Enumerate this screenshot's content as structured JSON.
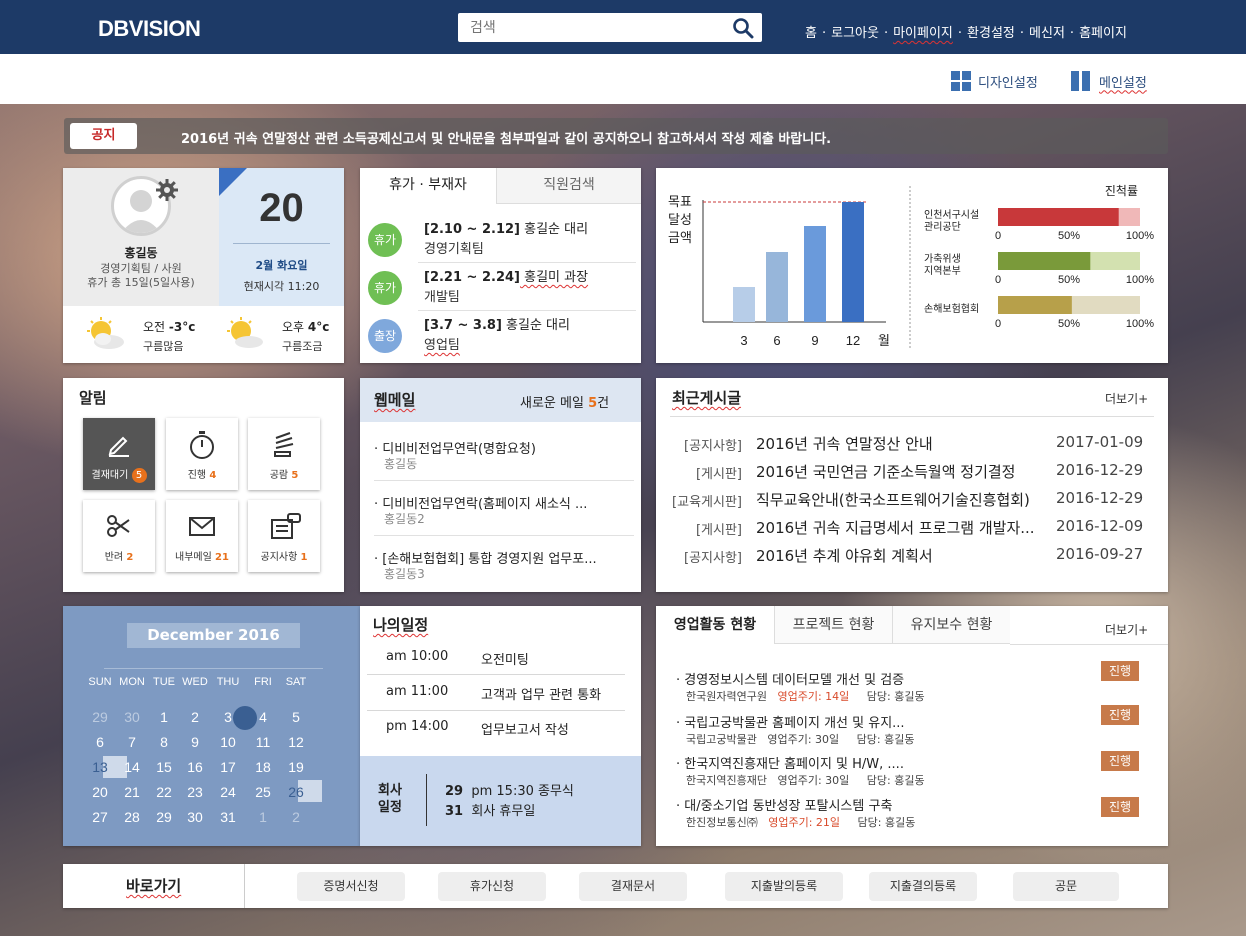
{
  "header": {
    "logo": "DBVISION",
    "search_placeholder": "검색",
    "nav": [
      "홈",
      "로그아웃",
      "마이페이지",
      "환경설정",
      "메신저",
      "홈페이지"
    ]
  },
  "subbar": {
    "design_setting": "디자인설정",
    "main_setting": "메인설정"
  },
  "notice": {
    "badge": "공지",
    "text": "2016년 귀속 연말정산 관련 소득공제신고서 및 안내문을 첨부파일과 같이 공지하오니 참고하셔서 작성 제출 바랍니다."
  },
  "profile": {
    "name": "홍길동",
    "dept": "경영기획팀 / 사원",
    "vacation": "휴가 총 15일(5일사용)",
    "day": "20",
    "date": "2월 화요일",
    "time": "현재시각 11:20",
    "weather_am": {
      "label": "오전",
      "temp": "-3",
      "unit": "°c",
      "desc": "구름많음"
    },
    "weather_pm": {
      "label": "오후",
      "temp": "4",
      "unit": "°c",
      "desc": "구름조금"
    }
  },
  "vacation": {
    "tab_active": "휴가 · 부재자",
    "tab_inactive": "직원검색",
    "rows": [
      {
        "badge": "휴가",
        "color": "#6fbf54",
        "period": "[2.10 ~ 2.12]",
        "person": " 홍길순 대리",
        "team": "경영기획팀"
      },
      {
        "badge": "휴가",
        "color": "#6fbf54",
        "period": "[2.21 ~ 2.24]",
        "person": " 홍길미 과장",
        "team": "개발팀"
      },
      {
        "badge": "출장",
        "color": "#7fa8dc",
        "period": "[3.7 ~ 3.8]",
        "person": " 홍길순 대리",
        "team": "영업팀"
      }
    ]
  },
  "chart_data": [
    {
      "type": "bar",
      "title": "",
      "ylabel": "목표 달성 금액",
      "categories": [
        "3",
        "6",
        "9",
        "12"
      ],
      "x_unit": "월",
      "values": [
        35,
        70,
        96,
        120
      ],
      "target": 120,
      "colors": [
        "#b7cde8",
        "#97b6da",
        "#6a9adb",
        "#3a6fc2"
      ]
    },
    {
      "type": "bar",
      "title": "진척률",
      "orientation": "horizontal",
      "categories": [
        "인천서구시설 관리공단",
        "가축위생 지역본부",
        "손해보험협회"
      ],
      "values": [
        85,
        65,
        52
      ],
      "xlim": [
        0,
        100
      ],
      "ticks": [
        "0",
        "50%",
        "100%"
      ],
      "colors": [
        "#c8383a",
        "#7a9a3a",
        "#b7a04a"
      ],
      "bg_colors": [
        "#f0b8b8",
        "#d3e1b0",
        "#e1dbc1"
      ]
    }
  ],
  "alerts": {
    "title": "알림",
    "tiles": [
      {
        "label": "결재대기",
        "count": "5",
        "icon": "pen-icon"
      },
      {
        "label": "진행",
        "count": "4",
        "icon": "stopwatch-icon"
      },
      {
        "label": "공람",
        "count": "5",
        "icon": "bookmark-icon"
      },
      {
        "label": "반려",
        "count": "2",
        "icon": "scissors-icon"
      },
      {
        "label": "내부메일",
        "count": "21",
        "icon": "mail-icon"
      },
      {
        "label": "공지사항",
        "count": "1",
        "icon": "notice-icon"
      }
    ]
  },
  "webmail": {
    "title": "웹메일",
    "new_prefix": "새로운 메일 ",
    "new_count": "5",
    "new_suffix": "건",
    "items": [
      {
        "subject": "· 디비비전업무연락(명함요청)",
        "from": "홍길동"
      },
      {
        "subject": "· 디비비전업무연락(홈페이지 새소식 ...",
        "from": "홍길동2"
      },
      {
        "subject": "· [손해보험협회] 통합 경영지원 업무포...",
        "from": "홍길동3"
      }
    ]
  },
  "recent": {
    "title": "최근게시글",
    "more": "더보기+",
    "posts": [
      {
        "cat": "[공지사항]",
        "title": "2016년 귀속 연말정산 안내",
        "date": "2017-01-09"
      },
      {
        "cat": "[게시판]",
        "title": "2016년 국민연금 기준소득월액 정기결정",
        "date": "2016-12-29"
      },
      {
        "cat": "[교육게시판]",
        "title": "직무교육안내(한국소프트웨어기술진흥협회)",
        "date": "2016-12-29"
      },
      {
        "cat": "[게시판]",
        "title": "2016년 귀속 지급명세서 프로그램 개발자...",
        "date": "2016-12-09"
      },
      {
        "cat": "[공지사항]",
        "title": "2016년 추계 야유회 계획서",
        "date": "2016-09-27"
      }
    ]
  },
  "calendar": {
    "month": "December  2016",
    "days_header": [
      "SUN",
      "MON",
      "TUE",
      "WED",
      "THU",
      "FRI",
      "SAT"
    ],
    "weeks": [
      [
        "29",
        "30",
        "1",
        "2",
        "3",
        "4",
        "5"
      ],
      [
        "6",
        "7",
        "8",
        "9",
        "10",
        "11",
        "12"
      ],
      [
        "13",
        "14",
        "15",
        "16",
        "17",
        "18",
        "19"
      ],
      [
        "20",
        "21",
        "22",
        "23",
        "24",
        "25",
        "26"
      ],
      [
        "27",
        "28",
        "29",
        "30",
        "31",
        "1",
        "2"
      ]
    ]
  },
  "schedule": {
    "title": "나의일정",
    "items": [
      {
        "time": "am 10:00",
        "text": "오전미팅"
      },
      {
        "time": "am 11:00",
        "text": "고객과 업무 관련 통화"
      },
      {
        "time": "pm 14:00",
        "text": "업무보고서 작성"
      }
    ],
    "company_label1": "회사",
    "company_label2": "일정",
    "company": [
      {
        "day": "29",
        "text": "pm 15:30 종무식"
      },
      {
        "day": "31",
        "text": "회사 휴무일"
      }
    ]
  },
  "projects": {
    "tabs": [
      "영업활동 현황",
      "프로젝트 현황",
      "유지보수 현황"
    ],
    "more": "더보기+",
    "items": [
      {
        "title": "· 경영정보시스템 데이터모델 개선 및 검증",
        "org": "한국원자력연구원",
        "cycle": "영업주기: 14일",
        "owner": "담당: 홍길동",
        "status": "진행",
        "red": true
      },
      {
        "title": "· 국립고궁박물관 홈페이지 개선 및 유지...",
        "org": "국립고궁박물관",
        "cycle": "영업주기: 30일",
        "owner": "담당: 홍길동",
        "status": "진행",
        "red": false
      },
      {
        "title": "· 한국지역진흥재단 홈페이지 및 H/W, ....",
        "org": "한국지역진흥재단",
        "cycle": "영업주기: 30일",
        "owner": "담당: 홍길동",
        "status": "진행",
        "red": false
      },
      {
        "title": "· 대/중소기업 동반성장 포탈시스템 구축",
        "org": "한진정보통신㈜",
        "cycle": "영업주기: 21일",
        "owner": "담당: 홍길동",
        "status": "진행",
        "red": true
      }
    ]
  },
  "shortcut": {
    "title": "바로가기",
    "buttons": [
      "증명서신청",
      "휴가신청",
      "결재문서",
      "지출발의등록",
      "지출결의등록",
      "공문"
    ]
  }
}
